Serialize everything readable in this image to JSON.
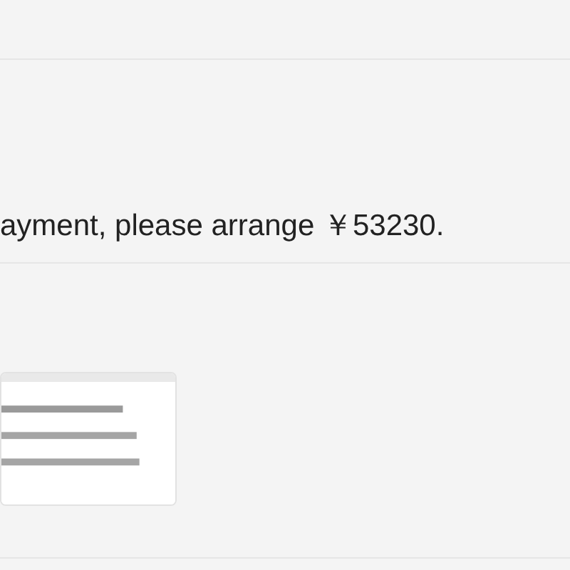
{
  "message": {
    "text": "ayment, please arrange ￥53230."
  }
}
